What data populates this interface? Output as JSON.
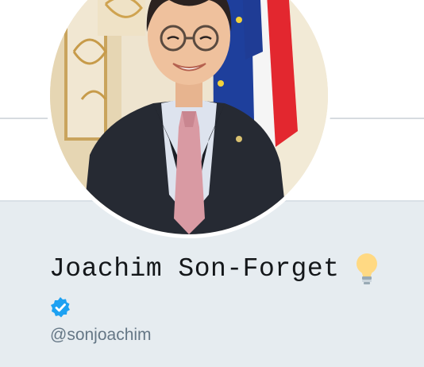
{
  "profile": {
    "display_name": "Joachim Son-Forget",
    "handle": "@sonjoachim",
    "verified": true,
    "name_emoji_icon": "light-bulb-icon",
    "verified_icon": "verified-badge-icon",
    "avatar_description": "profile-photo"
  },
  "colors": {
    "card_background": "#e6ecf0",
    "handle_text": "#657786",
    "name_text": "#14171a",
    "verified_blue": "#1da1f2"
  }
}
